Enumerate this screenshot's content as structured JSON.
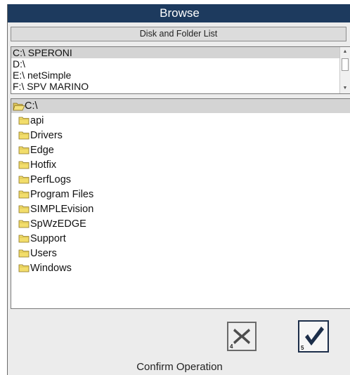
{
  "window": {
    "title": "Browse"
  },
  "disk_section": {
    "header": "Disk and Folder List",
    "items": [
      {
        "label": "C:\\ SPERONI",
        "selected": true
      },
      {
        "label": "D:\\",
        "selected": false
      },
      {
        "label": "E:\\ netSimple",
        "selected": false
      },
      {
        "label": "F:\\ SPV MARINO",
        "selected": false
      }
    ],
    "scroll": {
      "up_icon": "triangle-up",
      "down_icon": "triangle-down"
    }
  },
  "folder_tree": {
    "root": {
      "label": "C:\\",
      "icon": "open-folder-icon"
    },
    "folders": [
      "api",
      "Drivers",
      "Edge",
      "Hotfix",
      "PerfLogs",
      "Program Files",
      "SIMPLEvision",
      "SpWzEDGE",
      "Support",
      "Users",
      "Windows"
    ]
  },
  "actions": {
    "cancel": {
      "icon": "x-icon",
      "hotkey": "4"
    },
    "confirm": {
      "icon": "checkmark-icon",
      "hotkey": "5"
    },
    "label": "Confirm Operation"
  },
  "colors": {
    "titlebar": "#1d3a5e",
    "folder_yellow": "#f2dd6b",
    "selection": "#d4d4d4"
  }
}
